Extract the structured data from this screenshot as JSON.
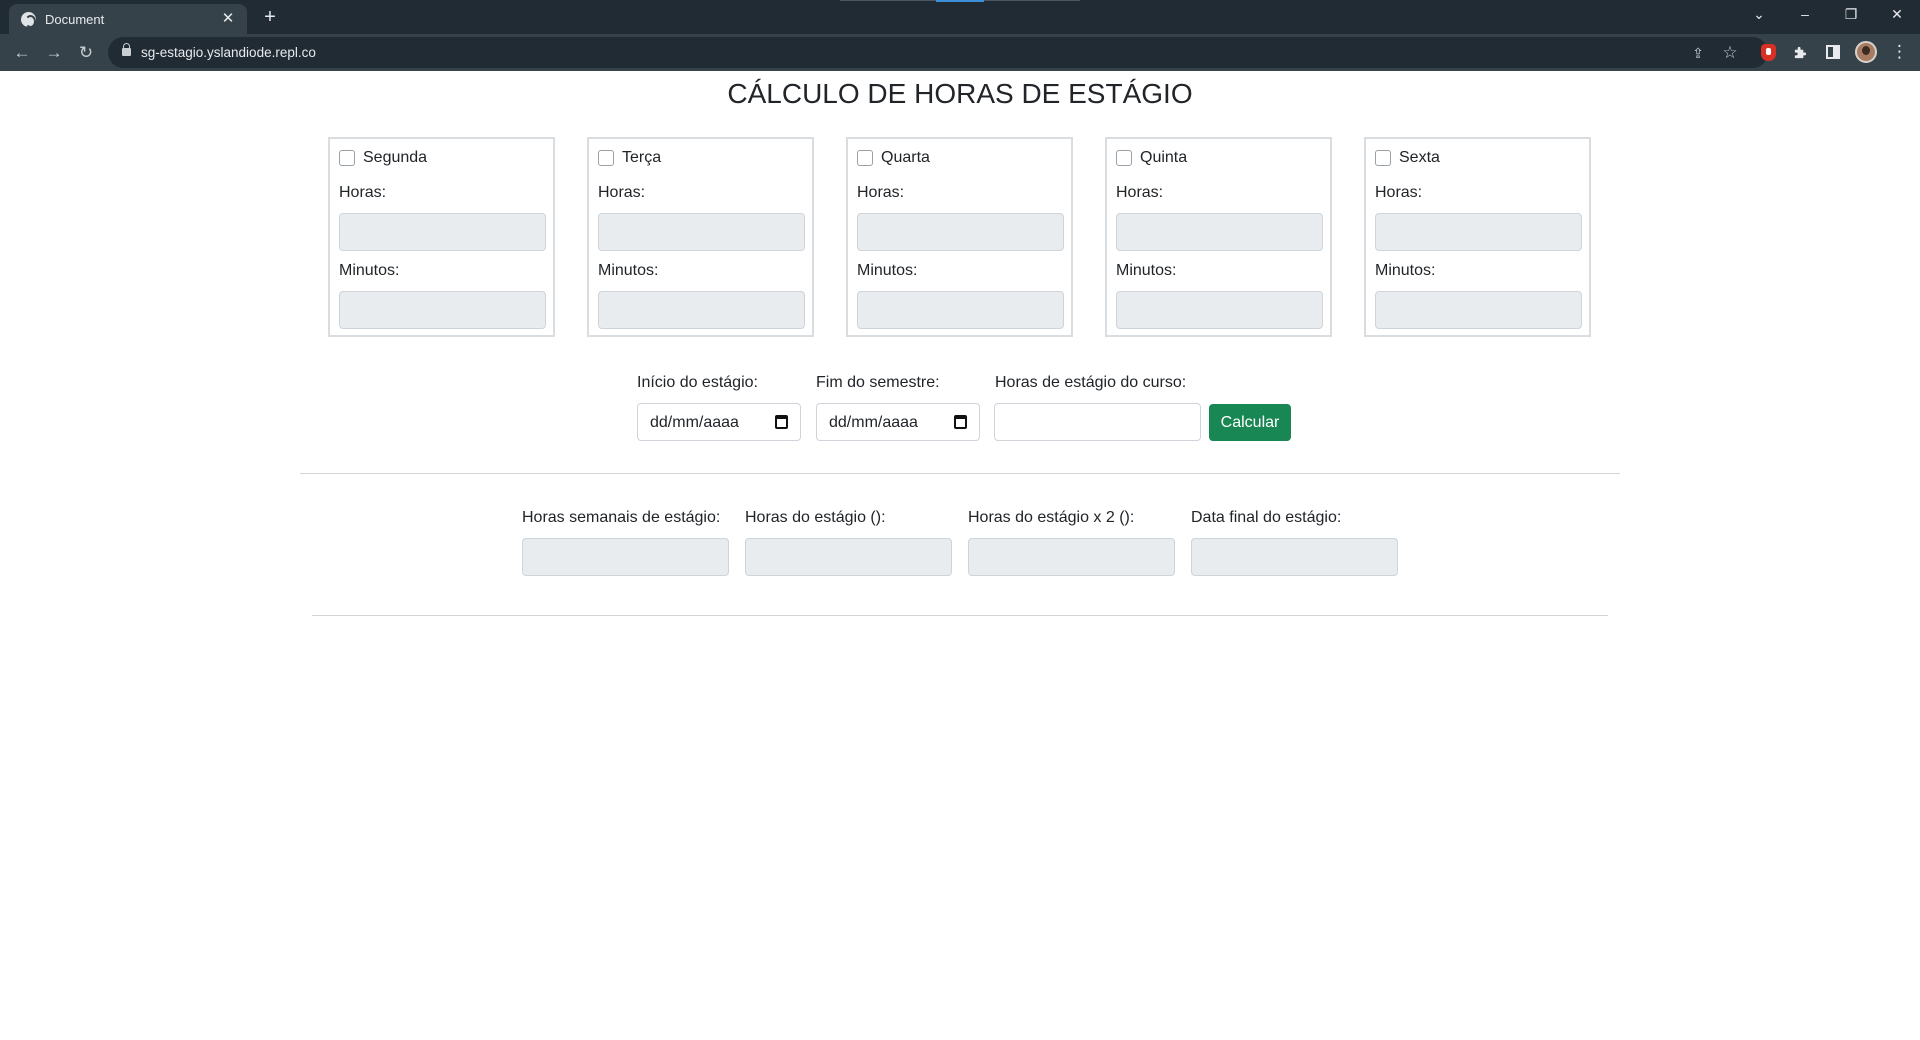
{
  "browser": {
    "tab_title": "Document",
    "tab_close": "✕",
    "new_tab": "+",
    "url": "sg-estagio.yslandiode.repl.co",
    "window_controls": {
      "dropdown": "⌄",
      "minimize": "–",
      "restore": "❐",
      "close": "✕"
    },
    "nav": {
      "back": "←",
      "forward": "→",
      "reload": "↻"
    },
    "toolbar_icons": [
      "share-icon",
      "star-icon",
      "extension-red-icon",
      "puzzle-icon",
      "side-panel-icon",
      "avatar",
      "kebab-menu-icon"
    ],
    "share_glyph": "⇪",
    "star_glyph": "☆",
    "menu_glyph": "⋮"
  },
  "page": {
    "title": "CÁLCULO DE HORAS DE ESTÁGIO",
    "days": [
      {
        "name": "Segunda",
        "hours_label": "Horas:",
        "minutes_label": "Minutos:",
        "checked": false
      },
      {
        "name": "Terça",
        "hours_label": "Horas:",
        "minutes_label": "Minutos:",
        "checked": false
      },
      {
        "name": "Quarta",
        "hours_label": "Horas:",
        "minutes_label": "Minutos:",
        "checked": false
      },
      {
        "name": "Quinta",
        "hours_label": "Horas:",
        "minutes_label": "Minutos:",
        "checked": false
      },
      {
        "name": "Sexta",
        "hours_label": "Horas:",
        "minutes_label": "Minutos:",
        "checked": false
      }
    ],
    "form": {
      "start_label": "Início do estágio:",
      "start_placeholder": "dd/mm/aaaa",
      "end_label": "Fim do semestre:",
      "end_placeholder": "dd/mm/aaaa",
      "course_hours_label": "Horas de estágio do curso:",
      "course_hours_value": "",
      "calculate_button": "Calcular"
    },
    "results": {
      "weekly_label": "Horas semanais de estágio:",
      "total_label": "Horas do estágio ():",
      "double_label": "Horas do estágio x 2 ():",
      "end_date_label": "Data final do estágio:"
    }
  },
  "colors": {
    "primary_button": "#198754",
    "disabled_field": "#e9ecef",
    "browser_frame": "#202b33",
    "browser_toolbar": "#35424a"
  }
}
